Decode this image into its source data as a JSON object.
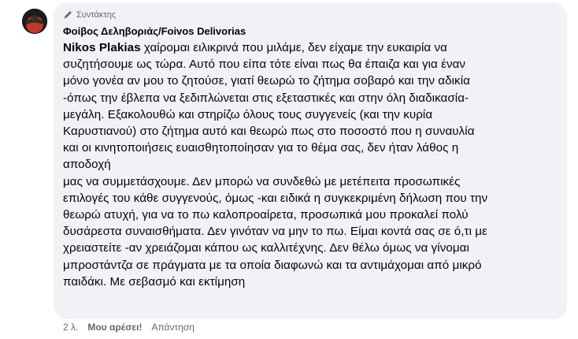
{
  "comment": {
    "badge_label": "Συντάκτης",
    "author": "Φοίβος Δεληβοριάς/Foivos Delivorias",
    "mention": "Nikos Plakias",
    "body_lines": [
      " χαίρομαι ειλικρινά που μιλάμε, δεν είχαμε την ευκαιρία να",
      "συζητήσουμε ως τώρα. Αυτό που είπα τότε είναι πως θα έπαιζα και για έναν",
      "μόνο γονέα αν μου το ζητούσε, γιατί θεωρώ το ζήτημα σοβαρό και την αδικία",
      "-όπως την έβλεπα να ξεδιπλώνεται στις εξεταστικές και στην όλη διαδικασία-",
      "μεγάλη. Εξακολουθώ και στηρίζω όλους τους συγγενείς (και την κυρία",
      "Καρυστιανού) στο ζήτημα αυτό και θεωρώ πως στο ποσοστό που η συναυλία",
      "και οι κινητοποιήσεις ευαισθητοποίησαν για το θέμα σας, δεν ήταν λάθος η",
      "αποδοχή",
      "μας να συμμετάσχουμε. Δεν μπορώ να συνδεθώ με μετέπειτα προσωπικές",
      "επιλογές του κάθε συγγενούς, όμως -και ειδικά η συγκεκριμένη δήλωση που την",
      "θεωρώ ατυχή, για να το πω καλοπροαίρετα, προσωπικά μου προκαλεί πολύ",
      "δυσάρεστα συναισθήματα. Δεν γινόταν να μην το πω. Είμαι κοντά σας σε ό,τι με",
      "χρειαστείτε -αν χρειάζομαι κάπου ως καλλιτέχνης. Δεν θέλω όμως να γίνομαι",
      "μπροστάντζα σε πράγματα με τα οποία διαφωνώ και τα αντιμάχομαι από μικρό",
      "παιδάκι. Με σεβασμό και εκτίμηση"
    ],
    "timestamp": "2 λ.",
    "like_label": "Μου αρέσει!",
    "reply_label": "Απάντηση"
  },
  "icons": {
    "avatar": "avatar-image",
    "badge": "pen-icon"
  },
  "colors": {
    "bubble_bg": "#f0f2f5",
    "text": "#050505",
    "secondary": "#65676b"
  }
}
